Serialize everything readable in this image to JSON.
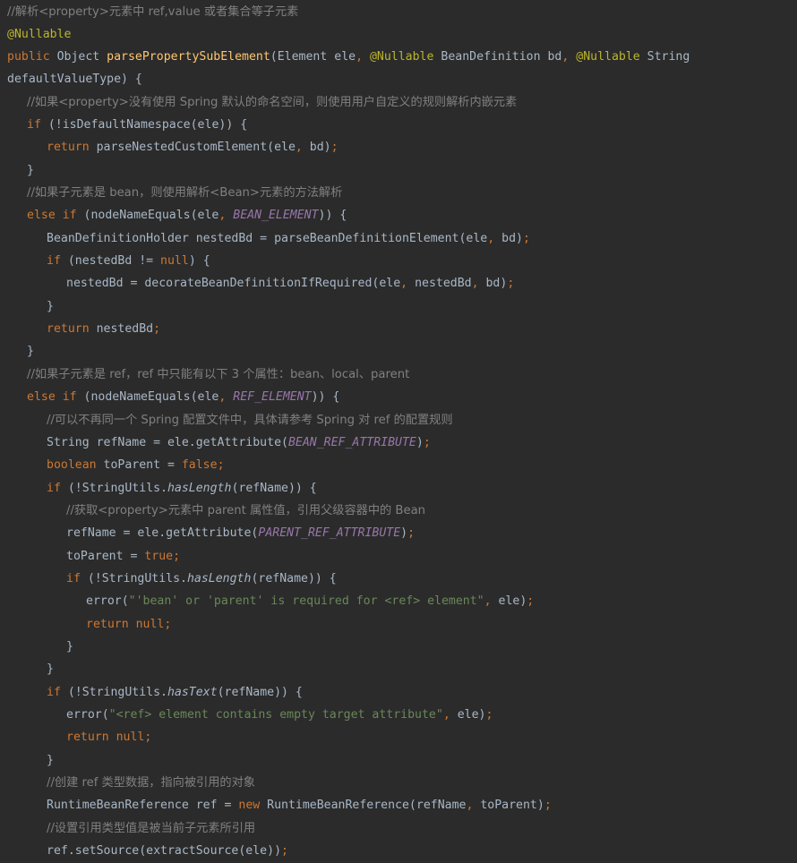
{
  "code": {
    "l01": "//解析<property>元素中 ref,value 或者集合等子元素",
    "l02_ann": "@Nullable",
    "l03": {
      "kw": "public",
      "a": " Object ",
      "fn": "parsePropertySubElement",
      "b": "(Element ele",
      "c1": ", ",
      "ann1": "@Nullable",
      "d": " BeanDefinition bd",
      "c2": ", ",
      "ann2": "@Nullable",
      "e": " String"
    },
    "l04": "defaultValueType) {",
    "l05": "//如果<property>没有使用 Spring 默认的命名空间，则使用用户自定义的规则解析内嵌元素",
    "l06": {
      "kw": "if",
      "a": " (!isDefaultNamespace(ele)) {"
    },
    "l07": {
      "kw": "return",
      "a": " parseNestedCustomElement(ele",
      "c": ", ",
      "b": "bd)",
      "s": ";"
    },
    "l08": "}",
    "l09": "//如果子元素是 bean，则使用解析<Bean>元素的方法解析",
    "l10": {
      "kw": "else if",
      "a": " (nodeNameEquals(ele",
      "c": ", ",
      "cst": "BEAN_ELEMENT",
      "b": ")) {"
    },
    "l11": {
      "a": "BeanDefinitionHolder nestedBd = parseBeanDefinitionElement(ele",
      "c": ", ",
      "b": "bd)",
      "s": ";"
    },
    "l12": {
      "kw": "if",
      "a": " (nestedBd != ",
      "kw2": "null",
      "b": ") {"
    },
    "l13": {
      "a": "nestedBd = decorateBeanDefinitionIfRequired(ele",
      "c1": ", ",
      "b": "nestedBd",
      "c2": ", ",
      "d": "bd)",
      "s": ";"
    },
    "l14": "}",
    "l15": {
      "kw": "return",
      "a": " nestedBd",
      "s": ";"
    },
    "l16": "}",
    "l17": "//如果子元素是 ref，ref 中只能有以下 3 个属性：bean、local、parent",
    "l18": {
      "kw": "else if",
      "a": " (nodeNameEquals(ele",
      "c": ", ",
      "cst": "REF_ELEMENT",
      "b": ")) {"
    },
    "l19": "//可以不再同一个 Spring 配置文件中，具体请参考 Spring 对 ref 的配置规则",
    "l20": {
      "a": "String refName = ele.getAttribute(",
      "cst": "BEAN_REF_ATTRIBUTE",
      "b": ")",
      "s": ";"
    },
    "l21": {
      "kw": "boolean",
      "a": " toParent = ",
      "kw2": "false",
      "s": ";"
    },
    "l22": {
      "kw": "if",
      "a": " (!StringUtils.",
      "it": "hasLength",
      "b": "(refName)) {"
    },
    "l23": "//获取<property>元素中 parent 属性值，引用父级容器中的 Bean",
    "l24": {
      "a": "refName = ele.getAttribute(",
      "cst": "PARENT_REF_ATTRIBUTE",
      "b": ")",
      "s": ";"
    },
    "l25": {
      "a": "toParent = ",
      "kw2": "true",
      "s": ";"
    },
    "l26": {
      "kw": "if",
      "a": " (!StringUtils.",
      "it": "hasLength",
      "b": "(refName)) {"
    },
    "l27": {
      "a": "error(",
      "str": "\"'bean' or 'parent' is required for <ref> element\"",
      "c": ", ",
      "b": "ele)",
      "s": ";"
    },
    "l28": {
      "kw": "return",
      "a": " ",
      "kw2": "null",
      "s": ";"
    },
    "l29": "}",
    "l30": "}",
    "l31": {
      "kw": "if",
      "a": " (!StringUtils.",
      "it": "hasText",
      "b": "(refName)) {"
    },
    "l32": {
      "a": "error(",
      "str": "\"<ref> element contains empty target attribute\"",
      "c": ", ",
      "b": "ele)",
      "s": ";"
    },
    "l33": {
      "kw": "return",
      "a": " ",
      "kw2": "null",
      "s": ";"
    },
    "l34": "}",
    "l35": "//创建 ref 类型数据，指向被引用的对象",
    "l36": {
      "a": "RuntimeBeanReference ref = ",
      "kw": "new",
      "b": " RuntimeBeanReference(refName",
      "c": ", ",
      "d": "toParent)",
      "s": ";"
    },
    "l37": "//设置引用类型值是被当前子元素所引用",
    "l38": {
      "a": "ref.setSource(extractSource(ele))",
      "s": ";"
    }
  }
}
